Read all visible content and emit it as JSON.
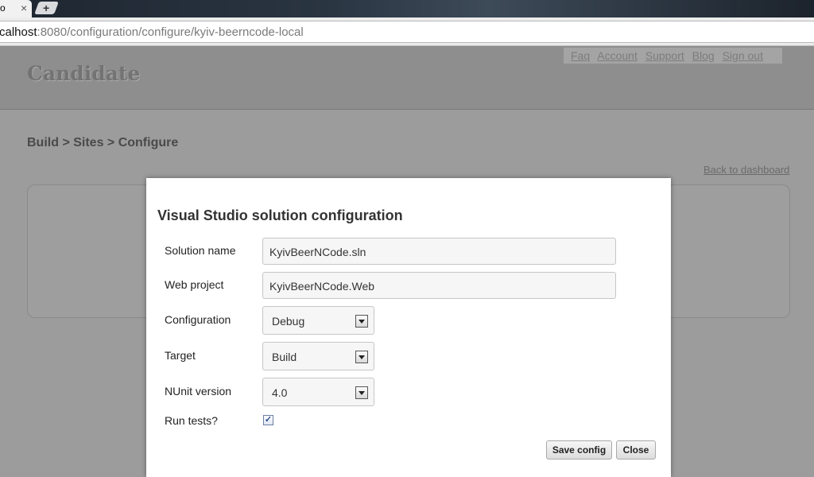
{
  "browser": {
    "tab_title": "o",
    "tab_close": "×",
    "new_tab": "+",
    "url_host": "calhost",
    "url_rest": ":8080/configuration/configure/kyiv-beerncode-local"
  },
  "header": {
    "logo": "Candidate",
    "nav": [
      "Faq",
      "Account",
      "Support",
      "Blog",
      "Sign out"
    ]
  },
  "page": {
    "breadcrumb": "Build > Sites > Configure",
    "back_link": "Back to dashboard"
  },
  "modal": {
    "title": "Visual Studio solution configuration",
    "solution_name": {
      "label": "Solution name",
      "value": "KyivBeerNCode.sln"
    },
    "web_project": {
      "label": "Web project",
      "value": "KyivBeerNCode.Web"
    },
    "configuration": {
      "label": "Configuration",
      "value": "Debug"
    },
    "target": {
      "label": "Target",
      "value": "Build"
    },
    "nunit_version": {
      "label": "NUnit version",
      "value": "4.0"
    },
    "run_tests": {
      "label": "Run tests?",
      "checked": true,
      "mark": "✓"
    },
    "save_label": "Save config",
    "close_label": "Close"
  }
}
